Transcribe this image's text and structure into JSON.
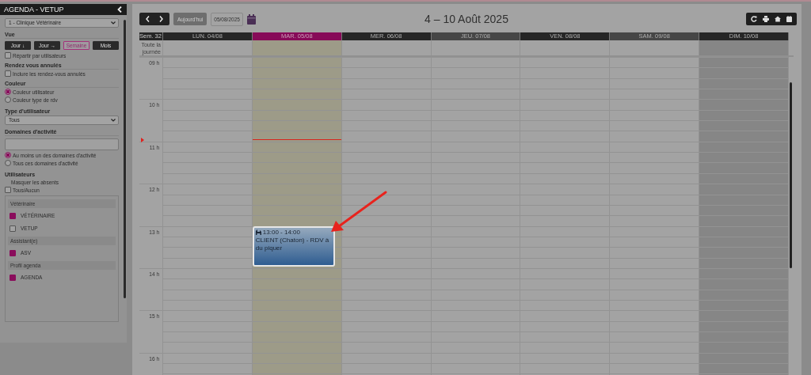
{
  "sidebar": {
    "title": "AGENDA - VETUP",
    "clinic": "1 - Clinique Vétérinaire",
    "view": {
      "label": "Vue",
      "buttons": [
        {
          "label": "Jour ↓",
          "selected": false
        },
        {
          "label": "Jour →",
          "selected": false
        },
        {
          "label": "Semaine",
          "selected": true
        },
        {
          "label": "Mois",
          "selected": false
        }
      ],
      "split": {
        "label": "Répartir par utilisateurs",
        "checked": false
      }
    },
    "cancelled": {
      "label": "Rendez vous annulés",
      "include": {
        "label": "Inclure les rendez-vous annulés",
        "checked": false
      }
    },
    "color": {
      "label": "Couleur",
      "options": [
        {
          "label": "Couleur utilisateur",
          "selected": true
        },
        {
          "label": "Couleur type de rdv",
          "selected": false
        }
      ]
    },
    "user_type": {
      "label": "Type d'utilisateur",
      "value": "Tous"
    },
    "domains": {
      "label": "Domaines d'activité",
      "options": [
        {
          "label": "Au moins un des domaines d'activité",
          "selected": true
        },
        {
          "label": "Tous ces domaines d'activité",
          "selected": false
        }
      ]
    },
    "users": {
      "label": "Utilisateurs",
      "hide_absent": "Masquer les absents",
      "all_none": {
        "label": "Tous/Aucun",
        "checked": false
      },
      "groups": [
        {
          "name": "Vétérinaire",
          "users": [
            {
              "name": "VÉTÉRINAIRE",
              "checked": true
            },
            {
              "name": "VETUP",
              "checked": false
            }
          ]
        },
        {
          "name": "Assistant(e)",
          "users": [
            {
              "name": "ASV",
              "checked": true
            }
          ]
        },
        {
          "name": "Profil agenda",
          "users": [
            {
              "name": "AGENDA",
              "checked": true
            }
          ]
        }
      ]
    }
  },
  "calendar": {
    "today": "Aujourd'hui",
    "date": "05/08/2025",
    "title": "4 – 10 Août 2025",
    "week": "Sem. 32",
    "all_day": "Toute la journée",
    "days": [
      {
        "label": "LUN. 04/08",
        "selected": false,
        "shaded": false
      },
      {
        "label": "MAR. 05/08",
        "selected": true,
        "shaded": false,
        "events": [
          {
            "time": "13:00 - 14:00",
            "title": "CLIENT (Chaton) - RDV à du piquer"
          }
        ]
      },
      {
        "label": "MER. 06/08",
        "selected": false,
        "shaded": false
      },
      {
        "label": "JEU. 07/08",
        "selected": false,
        "shaded": false
      },
      {
        "label": "VEN. 08/08",
        "selected": false,
        "shaded": false
      },
      {
        "label": "SAM. 09/08",
        "selected": false,
        "shaded": false
      },
      {
        "label": "DIM. 10/08",
        "selected": false,
        "shaded": true
      }
    ],
    "hours": [
      "09 h",
      "10 h",
      "11 h",
      "12 h",
      "13 h",
      "14 h",
      "15 h",
      "16 h"
    ]
  }
}
